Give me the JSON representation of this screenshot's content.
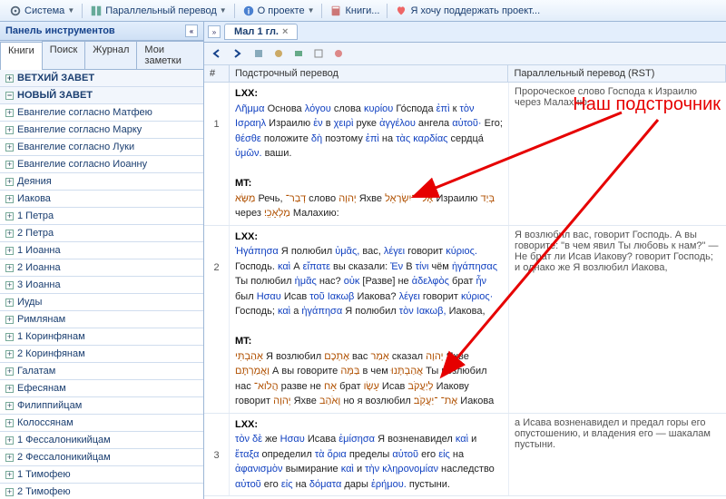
{
  "topmenu": {
    "system": "Система",
    "parallel": "Параллельный перевод",
    "about": "О проекте",
    "books": "Книги...",
    "support": "Я хочу поддержать проект..."
  },
  "sidebar": {
    "title": "Панель инструментов",
    "tabs": [
      "Книги",
      "Поиск",
      "Журнал",
      "Мои заметки"
    ],
    "ot": "ВЕТХИЙ ЗАВЕТ",
    "nt": "НОВЫЙ ЗАВЕТ",
    "books": [
      "Евангелие согласно Матфею",
      "Евангелие согласно Марку",
      "Евангелие согласно Луки",
      "Евангелие согласно Иоанну",
      "Деяния",
      "Иакова",
      "1 Петра",
      "2 Петра",
      "1 Иоанна",
      "2 Иоанна",
      "3 Иоанна",
      "Иуды",
      "Римлянам",
      "1 Коринфянам",
      "2 Коринфянам",
      "Галатам",
      "Ефесянам",
      "Филиппийцам",
      "Колоссянам",
      "1 Фессалоникийцам",
      "2 Фессалоникийцам",
      "1 Тимофею",
      "2 Тимофею"
    ]
  },
  "content": {
    "tab": "Мал 1 гл.",
    "col_num": "#",
    "col_inter": "Подстрочный перевод",
    "col_par": "Параллельный перевод (RST)",
    "verses": [
      {
        "num": "1",
        "lxx": "Λῆμμα Основа λόγου слова κυρίου Го́спода ἐπὶ к τὸν Ισραηλ Израилю ἐν в χειρὶ руке ἀγγέλου ангела αὐτοῦ· Его; θέσθε положите δὴ поэтому ἐπὶ на τὰς καρδίας сердца́ ὑμῶν. ваши.",
        "mt": "מַשָּׂא Речь, דְבַר־ слово יְהוָה Яхве אֶל־ ־יִשְׂרָאֵל Израилю בְּיַד через מַלְאָכִֽי׃ Малахию:",
        "par": "Пророческое слово Господа к Израилю через Малахию."
      },
      {
        "num": "2",
        "lxx": "Ἠγάπησα Я полюбил ὑμᾶς, вас, λέγει говорит κύριος. Господь. καὶ А εἴπατε вы сказали: Ἐν В τίνι чём ἠγάπησας Ты полюбил ἡμᾶς нас? οὐκ [Разве] не ἀδελφὸς брат ἦν был Ησαυ Исав τοῦ Ιακωβ Иакова? λέγει говорит κύριος· Господь; καὶ а ἠγάπησα Я полюбил τὸν Ιακωβ, Иакова,",
        "mt": "אָהַבְתִּי Я возлюбил אֶתְכֶם вас אָמַר сказал יְהוָה Яхве וַאֲמַרְתֶּם А вы говорите בַּמָּה в чем אֲהַבְתָּנוּ Ты возлюбил нас הֲלֹוא־ разве не אָח брат עֵשָׂו Исав לְיַעֲקֹב Иакову говорит יְהוָה Яхве וָאֹהַב но я возлюбил אֶת־ ־יַעֲקֹֽב׃ Иакова",
        "par": "Я возлюбил вас, говорит Господь. А вы говорите: \"в чем явил Ты любовь к нам?\" — Не брат ли Исав Иакову? говорит Господь; и однако же Я возлюбил Иакова,"
      },
      {
        "num": "3",
        "lxx": "τὸν δὲ же Ησαυ Исава ἐμίσησα Я возненавидел καὶ и ἔταξα определил τὰ ὅρια пределы αὐτοῦ его εἰς на ἀφανισμὸν вымирание καὶ и τὴν κληρονομίαν наследство αὐτοῦ его εἰς на δόματα дары ἐρήμου. пустыни.",
        "mt": "",
        "par": "а Исава возненавидел и предал горы его опустошению, и владения его — шакалам пустыни."
      }
    ]
  },
  "annotation": "Наш подстрочник",
  "labels": {
    "lxx": "LXX:",
    "mt": "MT:"
  }
}
